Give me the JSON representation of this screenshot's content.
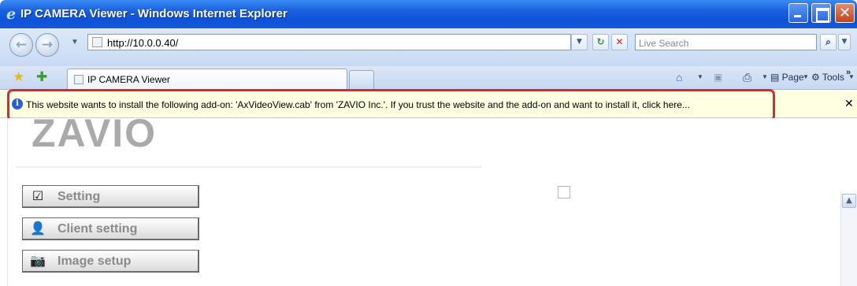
{
  "window": {
    "title": "IP CAMERA Viewer - Windows Internet Explorer",
    "title_bar_color": "#0d52d8"
  },
  "address_bar": {
    "url": "http://10.0.0.40/",
    "search_placeholder": "Live Search"
  },
  "tabs": [
    {
      "label": "IP CAMERA Viewer",
      "active": true
    }
  ],
  "command_bar": {
    "page_label": "Page",
    "tools_label": "Tools"
  },
  "info_bar": {
    "message": "This website wants to install the following add-on: 'AxVideoView.cab' from 'ZAVIO Inc.'. If you trust the website and the add-on and want to install it, click here...",
    "background": "#ffffe1",
    "highlight_color": "#e0262c"
  },
  "page": {
    "logo_text": "ZAVIO",
    "menu": [
      {
        "label": "Setting",
        "icon": "checkbox-icon"
      },
      {
        "label": "Client setting",
        "icon": "user-icon"
      },
      {
        "label": "Image setup",
        "icon": "camera-icon"
      }
    ]
  },
  "icons": {
    "ie": "ie-logo-icon",
    "back": "back-arrow-icon",
    "forward": "forward-arrow-icon",
    "refresh": "refresh-icon",
    "stop": "stop-icon",
    "search": "search-icon",
    "favorites": "favorites-star-icon",
    "add_favorites": "add-favorites-icon",
    "home": "home-icon",
    "feeds": "feeds-icon",
    "print": "print-icon",
    "info": "info-icon",
    "close": "close-icon"
  }
}
